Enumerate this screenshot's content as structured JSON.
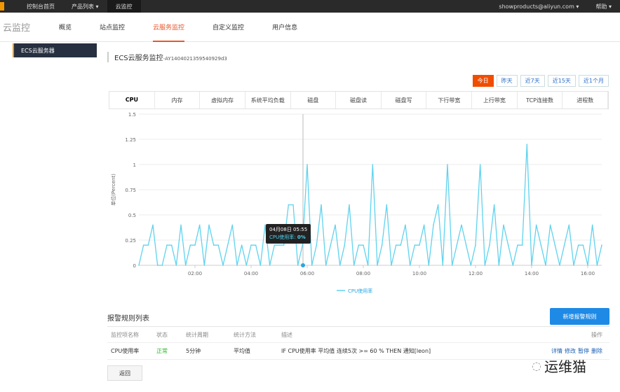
{
  "topbar": {
    "items": [
      "控制台首页",
      "产品列表 ▾",
      "云监控"
    ],
    "user": "showproducts@aliyun.com ▾",
    "help": "帮助 ▾"
  },
  "nav": {
    "brand": "云监控",
    "items": [
      "概览",
      "站点监控",
      "云服务监控",
      "自定义监控",
      "用户信息"
    ],
    "active": 2
  },
  "sidebar": {
    "item": "ECS云服务器"
  },
  "page": {
    "title": "ECS云服务监控",
    "instance": "-AY1404021359540929d3"
  },
  "ranges": {
    "items": [
      "今日",
      "昨天",
      "近7天",
      "近15天",
      "近1个月"
    ],
    "active": 0
  },
  "metric_tabs": {
    "items": [
      "CPU",
      "内存",
      "虚拟内存",
      "系统平均负载",
      "磁盘",
      "磁盘读",
      "磁盘写",
      "下行带宽",
      "上行带宽",
      "TCP连接数",
      "进程数"
    ],
    "active": 0
  },
  "tooltip": {
    "time": "04月08日 05:55",
    "series": "CPU使用率:",
    "value": "0%"
  },
  "colors": {
    "line": "#5fd3ee",
    "accent": "#f04d00",
    "primary": "#1e8ae6"
  },
  "chart_data": {
    "type": "line",
    "ylabel": "单位(Percent)",
    "ylim": [
      0,
      1.5
    ],
    "yticks": [
      "0",
      "0.25",
      "0.5",
      "0.75",
      "1",
      "1.25",
      "1.5"
    ],
    "xticks": [
      "02:00",
      "04:00",
      "06:00",
      "08:00",
      "10:00",
      "12:00",
      "14:00",
      "16:00"
    ],
    "grid": true,
    "legend": "bottom",
    "series": [
      {
        "name": "CPU使用率",
        "x": [
          "00:00",
          "00:10",
          "00:20",
          "00:30",
          "00:40",
          "00:50",
          "01:00",
          "01:10",
          "01:20",
          "01:30",
          "01:40",
          "01:50",
          "02:00",
          "02:10",
          "02:20",
          "02:30",
          "02:40",
          "02:50",
          "03:00",
          "03:10",
          "03:20",
          "03:30",
          "03:40",
          "03:50",
          "04:00",
          "04:10",
          "04:20",
          "04:30",
          "04:40",
          "04:50",
          "05:00",
          "05:10",
          "05:20",
          "05:30",
          "05:40",
          "05:50",
          "06:00",
          "06:10",
          "06:20",
          "06:30",
          "06:40",
          "06:50",
          "07:00",
          "07:10",
          "07:20",
          "07:30",
          "07:40",
          "07:50",
          "08:00",
          "08:10",
          "08:20",
          "08:30",
          "08:40",
          "08:50",
          "09:00",
          "09:10",
          "09:20",
          "09:30",
          "09:40",
          "09:50",
          "10:00",
          "10:10",
          "10:20",
          "10:30",
          "10:40",
          "10:50",
          "11:00",
          "11:10",
          "11:20",
          "11:30",
          "11:40",
          "11:50",
          "12:00",
          "12:10",
          "12:20",
          "12:30",
          "12:40",
          "12:50",
          "13:00",
          "13:10",
          "13:20",
          "13:30",
          "13:40",
          "13:50",
          "14:00",
          "14:10",
          "14:20",
          "14:30",
          "14:40",
          "14:50",
          "15:00",
          "15:10",
          "15:20",
          "15:30",
          "15:40",
          "15:50",
          "16:00",
          "16:10",
          "16:20",
          "16:30"
        ],
        "values": [
          0,
          0.2,
          0.2,
          0.4,
          0,
          0,
          0.2,
          0.2,
          0,
          0.4,
          0,
          0.2,
          0.2,
          0.4,
          0,
          0.4,
          0.2,
          0.2,
          0,
          0.2,
          0.4,
          0,
          0.2,
          0,
          0.2,
          0.2,
          0,
          0.4,
          0,
          0.2,
          0.2,
          0.2,
          0.6,
          0.6,
          0,
          0.2,
          1.0,
          0,
          0.2,
          0.6,
          0,
          0.2,
          0.4,
          0,
          0.2,
          0.6,
          0,
          0.2,
          0.2,
          0,
          1.0,
          0,
          0.2,
          0.6,
          0,
          0.2,
          0.2,
          0.4,
          0,
          0.2,
          0.2,
          0.4,
          0,
          0.4,
          0.6,
          0,
          1.0,
          0,
          0.2,
          0.4,
          0.2,
          0,
          0.2,
          1.0,
          0,
          0.2,
          0.6,
          0,
          0.4,
          0.2,
          0,
          0.2,
          0.2,
          1.2,
          0,
          0.4,
          0.2,
          0,
          0.4,
          0.2,
          0,
          0.2,
          0.4,
          0,
          0.2,
          0.2,
          0,
          0.4,
          0,
          0.2
        ]
      }
    ]
  },
  "alerts": {
    "title": "报警规则列表",
    "add_label": "新增报警规则",
    "headers": [
      "监控项名称",
      "状态",
      "统计周期",
      "统计方法",
      "描述",
      "操作"
    ],
    "rows": [
      {
        "name": "CPU使用率",
        "status": "正常",
        "period": "5分钟",
        "method": "平均值",
        "desc": "IF CPU使用率 平均值 连续5次 >= 60 % THEN 通知[leon]",
        "ops": [
          "详情",
          "修改",
          "暂停",
          "删除"
        ]
      }
    ],
    "back_label": "返回"
  },
  "watermark": "运维猫"
}
